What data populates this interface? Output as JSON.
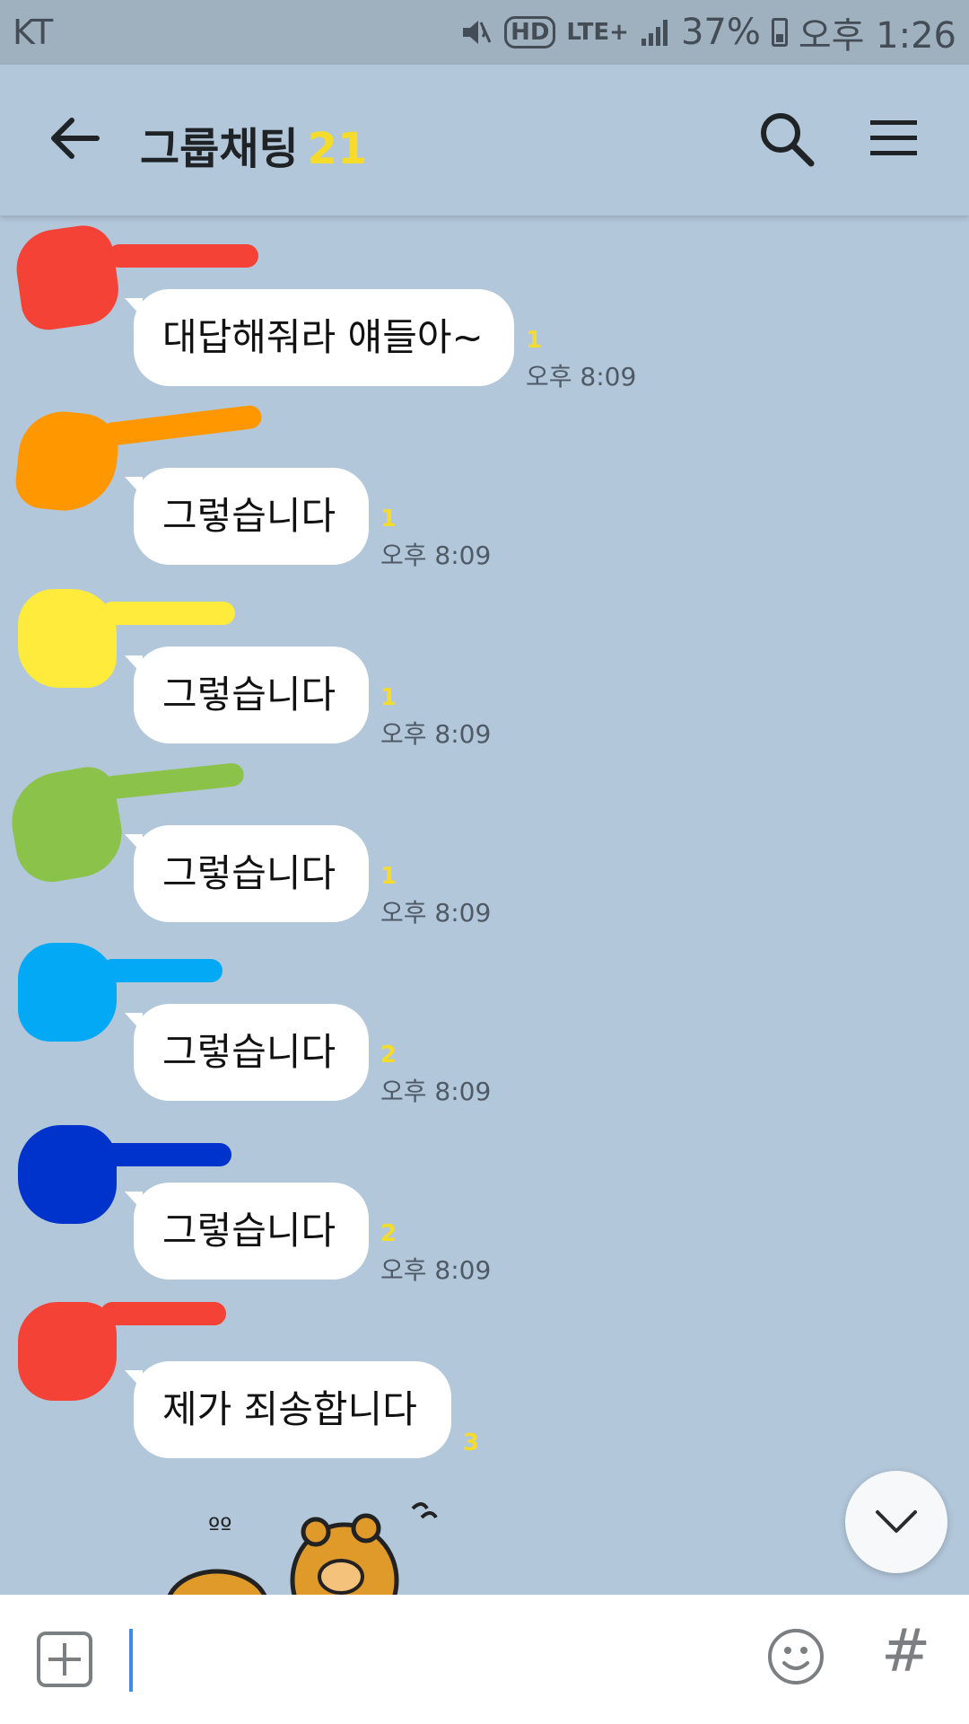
{
  "status_bar": {
    "carrier": "KT",
    "network": "LTE+",
    "hd": "HD",
    "battery": "37%",
    "time": "오후 1:26"
  },
  "header": {
    "title": "그룹채팅",
    "member_count": "21",
    "icons": [
      "back-arrow-icon",
      "search-icon",
      "menu-icon"
    ]
  },
  "messages": [
    {
      "text": "대답해줘라 얘들아~",
      "unread": "1",
      "time": "오후 8:09",
      "scribble_color": "#f44336"
    },
    {
      "text": "그렇습니다",
      "unread": "1",
      "time": "오후 8:09",
      "scribble_color": "#ff9800"
    },
    {
      "text": "그렇습니다",
      "unread": "1",
      "time": "오후 8:09",
      "scribble_color": "#ffeb3b"
    },
    {
      "text": "그렇습니다",
      "unread": "1",
      "time": "오후 8:09",
      "scribble_color": "#8bc34a"
    },
    {
      "text": "그렇습니다",
      "unread": "2",
      "time": "오후 8:09",
      "scribble_color": "#03a9f4"
    },
    {
      "text": "그렇습니다",
      "unread": "2",
      "time": "오후 8:09",
      "scribble_color": "#0033cc"
    },
    {
      "text": "제가 죄송합니다",
      "unread": "3",
      "time": "",
      "scribble_color": "#f44336"
    }
  ],
  "input": {
    "value": "",
    "placeholder": ""
  },
  "colors": {
    "background": "#b2c7da",
    "unread_badge": "#f5dc2a",
    "member_count": "#f5dc2a"
  }
}
